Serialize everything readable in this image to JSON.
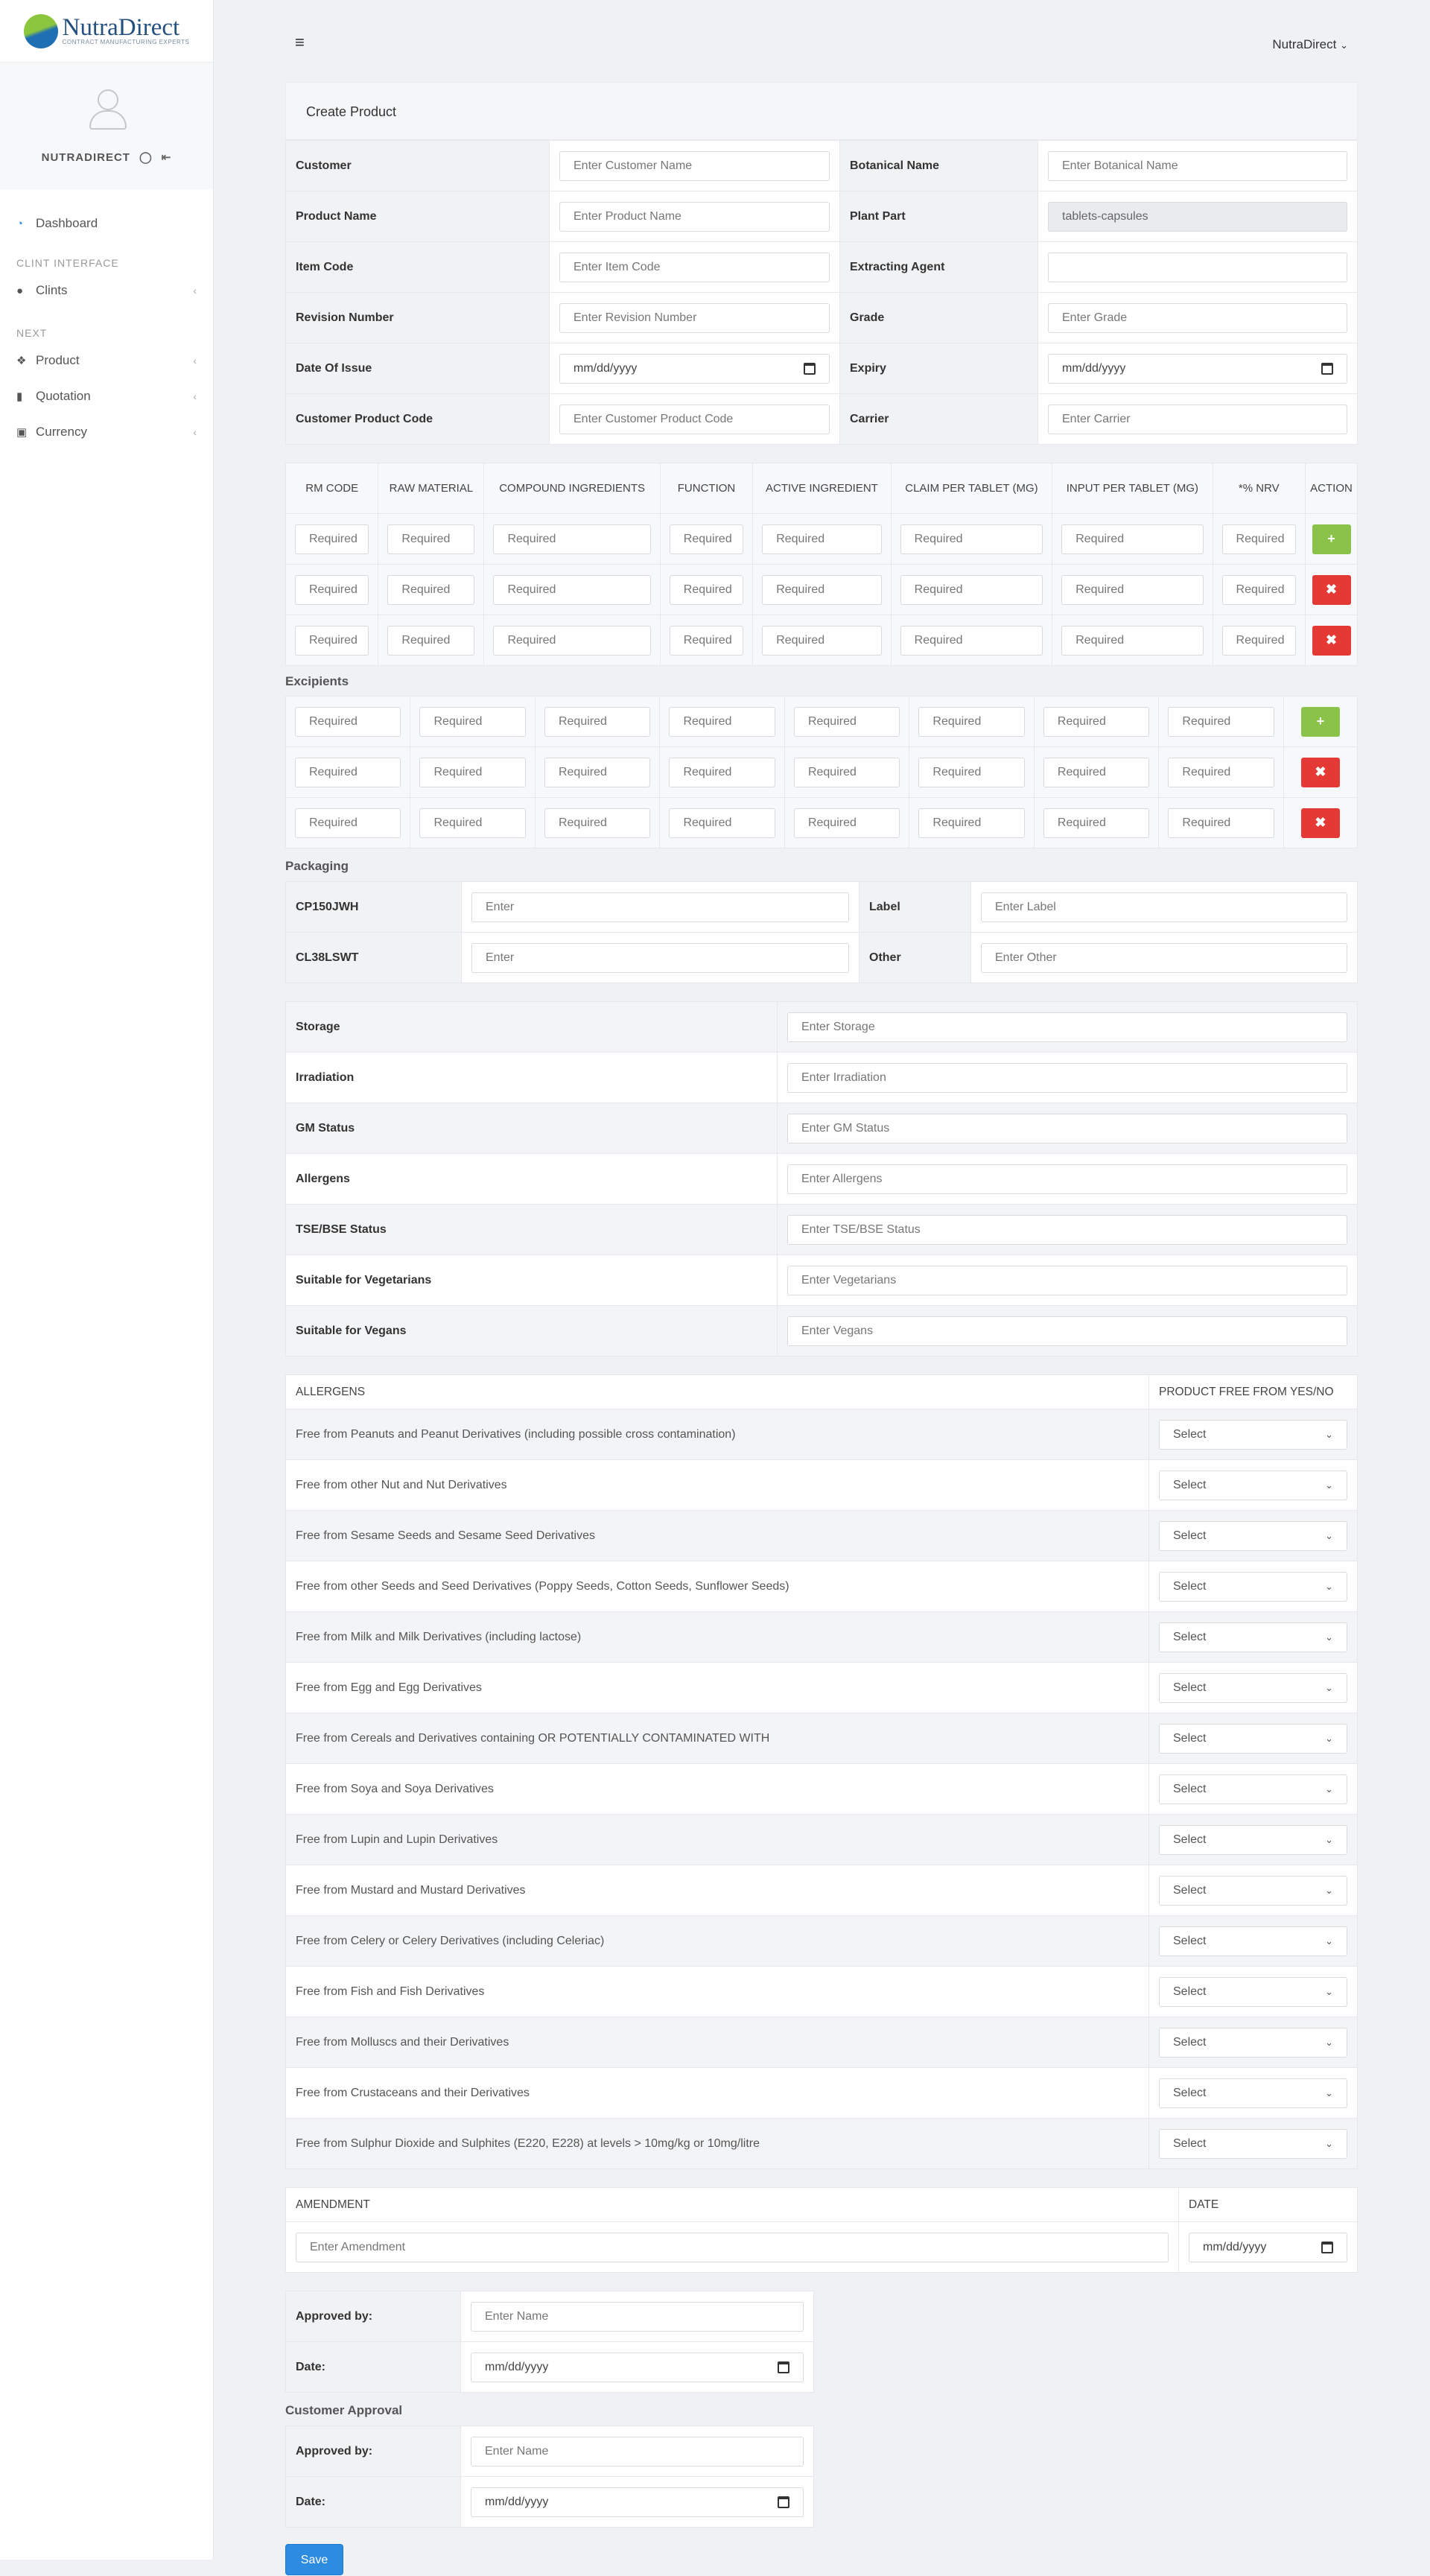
{
  "sidebar": {
    "brand": "NutraDirect",
    "tagline": "CONTRACT MANUFACTURING EXPERTS",
    "user": "NUTRADIRECT",
    "dashboard": "Dashboard",
    "section1": "CLINT INTERFACE",
    "clints": "Clints",
    "section2": "NEXT",
    "product": "Product",
    "quotation": "Quotation",
    "currency": "Currency"
  },
  "topbar": {
    "user": "NutraDirect"
  },
  "form": {
    "title": "Create Product",
    "rows": [
      {
        "l1": "Customer",
        "p1": "Enter Customer Name",
        "l2": "Botanical Name",
        "p2": "Enter Botanical Name"
      },
      {
        "l1": "Product Name",
        "p1": "Enter Product Name",
        "l2": "Plant Part",
        "p2": "tablets-capsules"
      },
      {
        "l1": "Item Code",
        "p1": "Enter Item Code",
        "l2": "Extracting Agent",
        "p2": ""
      },
      {
        "l1": "Revision Number",
        "p1": "Enter Revision Number",
        "l2": "Grade",
        "p2": "Enter Grade"
      },
      {
        "l1": "Date Of Issue",
        "p1": "mm/dd/yyyy",
        "l2": "Expiry",
        "p2": "mm/dd/yyyy"
      },
      {
        "l1": "Customer Product Code",
        "p1": "Enter Customer Product Code",
        "l2": "Carrier",
        "p2": "Enter Carrier"
      }
    ]
  },
  "grid": {
    "headers": [
      "RM CODE",
      "RAW MATERIAL",
      "COMPOUND INGREDIENTS",
      "FUNCTION",
      "ACTIVE INGREDIENT",
      "CLAIM PER TABLET (MG)",
      "INPUT PER TABLET (MG)",
      "*% NRV",
      "ACTION"
    ],
    "placeholder": "Required",
    "add": "+",
    "del": "✖"
  },
  "excipients_title": "Excipients",
  "packaging": {
    "title": "Packaging",
    "rows": [
      {
        "l1": "CP150JWH",
        "p1": "Enter",
        "l2": "Label",
        "p2": "Enter Label"
      },
      {
        "l1": "CL38LSWT",
        "p1": "Enter",
        "l2": "Other",
        "p2": "Enter Other"
      }
    ]
  },
  "props": [
    {
      "l": "Storage",
      "p": "Enter Storage"
    },
    {
      "l": "Irradiation",
      "p": "Enter Irradiation"
    },
    {
      "l": "GM Status",
      "p": "Enter GM Status"
    },
    {
      "l": "Allergens",
      "p": "Enter Allergens"
    },
    {
      "l": "TSE/BSE Status",
      "p": "Enter TSE/BSE Status"
    },
    {
      "l": "Suitable for Vegetarians",
      "p": "Enter Vegetarians"
    },
    {
      "l": "Suitable for Vegans",
      "p": "Enter Vegans"
    }
  ],
  "allergens": {
    "h1": "ALLERGENS",
    "h2": "PRODUCT FREE FROM YES/NO",
    "select": "Select",
    "items": [
      "Free from Peanuts and Peanut Derivatives (including possible cross contamination)",
      "Free from other Nut and Nut Derivatives",
      "Free from Sesame Seeds and Sesame Seed Derivatives",
      "Free from other Seeds and Seed Derivatives (Poppy Seeds, Cotton Seeds, Sunflower Seeds)",
      "Free from Milk and Milk Derivatives (including lactose)",
      "Free from Egg and Egg Derivatives",
      "Free from Cereals and Derivatives containing OR POTENTIALLY CONTAMINATED WITH",
      "Free from Soya and Soya Derivatives",
      "Free from Lupin and Lupin Derivatives",
      "Free from Mustard and Mustard Derivatives",
      "Free from Celery or Celery Derivatives (including Celeriac)",
      "Free from Fish and Fish Derivatives",
      "Free from Molluscs and their Derivatives",
      "Free from Crustaceans and their Derivatives",
      "Free from Sulphur Dioxide and Sulphites (E220, E228) at levels > 10mg/kg or 10mg/litre"
    ]
  },
  "amendment": {
    "h1": "AMENDMENT",
    "h2": "DATE",
    "p1": "Enter Amendment",
    "p2": "mm/dd/yyyy"
  },
  "approval": {
    "approved": "Approved by:",
    "date": "Date:",
    "name_ph": "Enter Name",
    "date_ph": "mm/dd/yyyy"
  },
  "customer_approval": {
    "title": "Customer Approval",
    "approved": "Approved by:",
    "date": "Date:",
    "name_ph": "Enter Name",
    "date_ph": "mm/dd/yyyy"
  },
  "save": "Save"
}
